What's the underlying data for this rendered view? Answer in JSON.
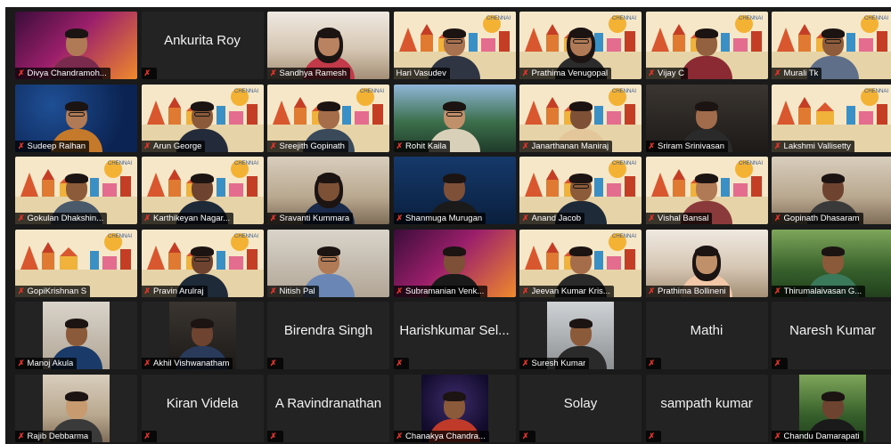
{
  "participants": [
    {
      "name": "Divya Chandramoh...",
      "muted": true,
      "type": "video",
      "bg": "pink",
      "skin": "#b07a56",
      "shirt": "#7a2b4d"
    },
    {
      "name": "",
      "big": "Ankurita Roy",
      "muted": true,
      "type": "name"
    },
    {
      "name": "Sandhya Ramesh",
      "muted": true,
      "type": "video",
      "bg": "room2",
      "skin": "#b98261",
      "shirt": "#c23a4a",
      "longhair": true
    },
    {
      "name": "Hari Vasudev",
      "muted": false,
      "type": "video",
      "bg": "chennai",
      "skin": "#a8714f",
      "shirt": "#2f3542",
      "active": true,
      "glasses": true
    },
    {
      "name": "Prathima Venugopal",
      "muted": true,
      "type": "video",
      "bg": "chennai",
      "skin": "#b07a56",
      "shirt": "#2b2b2b",
      "longhair": true,
      "glasses": true
    },
    {
      "name": "Vijay C",
      "muted": true,
      "type": "video",
      "bg": "chennai",
      "skin": "#93613f",
      "shirt": "#8b2a32"
    },
    {
      "name": "Murali Tk",
      "muted": true,
      "type": "video",
      "bg": "chennai",
      "skin": "#8e5b3c",
      "shirt": "#5f6f8a",
      "glasses": true
    },
    {
      "name": "Sudeep Ralhan",
      "muted": true,
      "type": "video",
      "bg": "blue-star",
      "skin": "#b07a56",
      "shirt": "#c47a2a",
      "glasses": true
    },
    {
      "name": "Arun George",
      "muted": true,
      "type": "video",
      "bg": "chennai",
      "skin": "#8a5a3b",
      "shirt": "#232a3a",
      "glasses": true
    },
    {
      "name": "Sreejith Gopinath",
      "muted": true,
      "type": "video",
      "bg": "chennai",
      "skin": "#a56d4a",
      "shirt": "#3a4a5a"
    },
    {
      "name": "Rohit Kaila",
      "muted": true,
      "type": "video",
      "bg": "pool",
      "skin": "#c0906a",
      "shirt": "#d8d0b8",
      "glasses": true
    },
    {
      "name": "Janarthanan Maniraj",
      "muted": true,
      "type": "video",
      "bg": "chennai",
      "skin": "#7e5036",
      "shirt": "#e3c79a"
    },
    {
      "name": "Sriram Srinivasan",
      "muted": true,
      "type": "video",
      "bg": "dark",
      "skin": "#a06c4c",
      "shirt": "#2a2a2a"
    },
    {
      "name": "Lakshmi Vallisetty",
      "muted": true,
      "type": "video",
      "bg": "chennai",
      "skin": "#b07a56",
      "shirt": "#2a2a2a",
      "empty": true
    },
    {
      "name": "Gokulan Dhakshin...",
      "muted": true,
      "type": "video",
      "bg": "chennai",
      "skin": "#8c5b3a",
      "shirt": "#4a5a6a"
    },
    {
      "name": "Karthikeyan Nagar...",
      "muted": true,
      "type": "video",
      "bg": "chennai",
      "skin": "#6e4430",
      "shirt": "#1e2a38"
    },
    {
      "name": "Sravanti Kummara",
      "muted": true,
      "type": "video",
      "bg": "room",
      "skin": "#7d5136",
      "shirt": "#1a2a4a",
      "longhair": true
    },
    {
      "name": "Shanmuga Murugan",
      "muted": true,
      "type": "video",
      "bg": "blue-star2",
      "skin": "#7e5038",
      "shirt": "#1a1a1a",
      "headset": true
    },
    {
      "name": "Anand Jacob",
      "muted": true,
      "type": "video",
      "bg": "chennai",
      "skin": "#8c5b3a",
      "shirt": "#1e2a38",
      "glasses": true
    },
    {
      "name": "Vishal Bansal",
      "muted": true,
      "type": "video",
      "bg": "chennai",
      "skin": "#b07a56",
      "shirt": "#8a3a3a"
    },
    {
      "name": "Gopinath Dhasaram",
      "muted": true,
      "type": "video",
      "bg": "room",
      "skin": "#6e4430",
      "shirt": "#3a3a3a"
    },
    {
      "name": "GopiKrishnan S",
      "muted": true,
      "type": "video",
      "bg": "chennai",
      "empty": true
    },
    {
      "name": "Pravin Arulraj",
      "muted": true,
      "type": "video",
      "bg": "chennai",
      "skin": "#6e4430",
      "shirt": "#1e2a38",
      "glasses": true
    },
    {
      "name": "Nitish Pal",
      "muted": true,
      "type": "video",
      "bg": "office",
      "skin": "#b07a56",
      "shirt": "#6a86b5",
      "glasses": true
    },
    {
      "name": "Subramanian Venk...",
      "muted": true,
      "type": "video",
      "bg": "pink",
      "skin": "#7e5038",
      "shirt": "#1a1a1a"
    },
    {
      "name": "Jeevan Kumar Kris...",
      "muted": true,
      "type": "video",
      "bg": "chennai",
      "skin": "#a56d4a",
      "shirt": "#2a2a2a"
    },
    {
      "name": "Prathima Bollineni",
      "muted": true,
      "type": "video",
      "bg": "room2",
      "skin": "#c0906a",
      "shirt": "#f2c7a8",
      "longhair": true
    },
    {
      "name": "Thirumalaivasan G...",
      "muted": true,
      "type": "video",
      "bg": "green",
      "skin": "#8a5a3b",
      "shirt": "#3a7a5a"
    },
    {
      "name": "Manoj Akula",
      "muted": true,
      "type": "pic",
      "bg": "office",
      "skin": "#8a5a3b",
      "shirt": "#1a3a6a"
    },
    {
      "name": "Akhil Vishwanatham",
      "muted": true,
      "type": "pic",
      "bg": "dark",
      "skin": "#6e4430",
      "shirt": "#2a3a5a"
    },
    {
      "name": "",
      "big": "Birendra Singh",
      "muted": true,
      "type": "name"
    },
    {
      "name": "",
      "big": "Harishkumar Sel...",
      "muted": true,
      "type": "name"
    },
    {
      "name": "Suresh Kumar",
      "muted": true,
      "type": "pic",
      "bg": "bike",
      "skin": "#8a5a3b",
      "shirt": "#2a2a2a"
    },
    {
      "name": "",
      "big": "Mathi",
      "muted": true,
      "type": "name"
    },
    {
      "name": "",
      "big": "Naresh Kumar",
      "muted": true,
      "type": "name"
    },
    {
      "name": "Rajib Debbarma",
      "muted": true,
      "type": "pic",
      "bg": "room",
      "skin": "#c79a70",
      "shirt": "#3a3a3a"
    },
    {
      "name": "",
      "big": "Kiran Videla",
      "muted": true,
      "type": "name"
    },
    {
      "name": "",
      "big": "A Ravindranathan",
      "muted": true,
      "type": "name"
    },
    {
      "name": "Chanakya Chandra...",
      "muted": true,
      "type": "pic",
      "bg": "fireworks",
      "skin": "#8a5a3b",
      "shirt": "#c03a2a"
    },
    {
      "name": "",
      "big": "Solay",
      "muted": true,
      "type": "name"
    },
    {
      "name": "",
      "big": "sampath kumar",
      "muted": true,
      "type": "name"
    },
    {
      "name": "Chandu Damarapati",
      "muted": true,
      "type": "pic",
      "bg": "green",
      "skin": "#6e4430",
      "shirt": "#1a1a1a"
    }
  ],
  "chennai_labels": {
    "city": "CHENNAI"
  }
}
